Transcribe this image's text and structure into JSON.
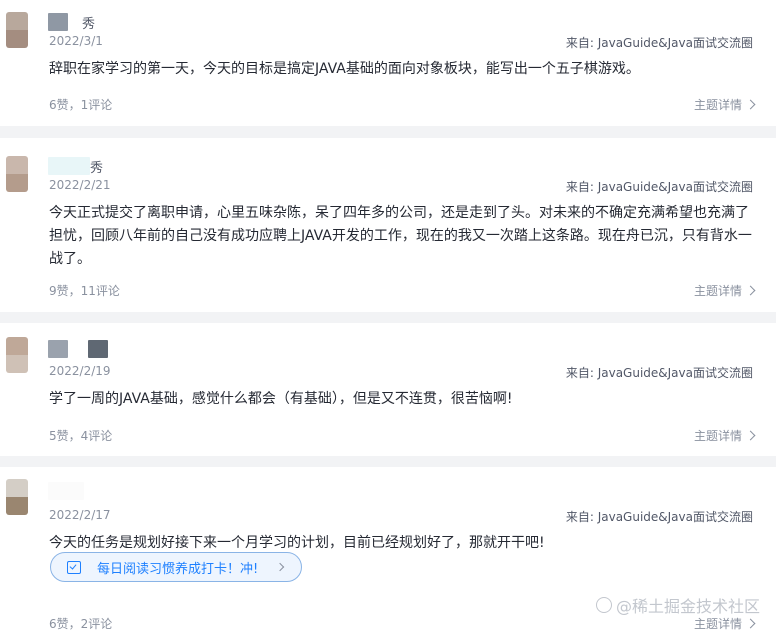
{
  "posts": [
    {
      "author_visible": "秀",
      "date": "2022/3/1",
      "source": "来自: JavaGuide&Java面试交流圈",
      "content": "辞职在家学习的第一天，今天的目标是搞定JAVA基础的面向对象板块，能写出一个五子棋游戏。",
      "stats": "6赞，1评论",
      "detail": "主题详情"
    },
    {
      "author_visible": "秀",
      "date": "2022/2/21",
      "source": "来自: JavaGuide&Java面试交流圈",
      "content": "今天正式提交了离职申请，心里五味杂陈，呆了四年多的公司，还是走到了头。对未来的不确定充满希望也充满了担忧，回顾八年前的自己没有成功应聘上JAVA开发的工作，现在的我又一次踏上这条路。现在舟已沉，只有背水一战了。",
      "stats": "9赞，11评论",
      "detail": "主题详情"
    },
    {
      "author_visible": "",
      "date": "2022/2/19",
      "source": "来自: JavaGuide&Java面试交流圈",
      "content": "学了一周的JAVA基础，感觉什么都会（有基础），但是又不连贯，很苦恼啊!",
      "stats": "5赞，4评论",
      "detail": "主题详情"
    },
    {
      "author_visible": "",
      "date": "2022/2/17",
      "source": "来自: JavaGuide&Java面试交流圈",
      "content": "今天的任务是规划好接下来一个月学习的计划，目前已经规划好了，那就开干吧!",
      "checkin": "每日阅读习惯养成打卡！冲!",
      "stats": "6赞，2评论",
      "detail": "主题详情"
    }
  ],
  "watermark": "@稀土掘金技术社区",
  "colors": {
    "link_blue": "#1e80ff",
    "muted": "#8a919f",
    "separator": "#f2f3f5"
  },
  "icons": [
    "chevron-right-icon",
    "checkin-calendar-icon",
    "juejin-logo-icon"
  ]
}
